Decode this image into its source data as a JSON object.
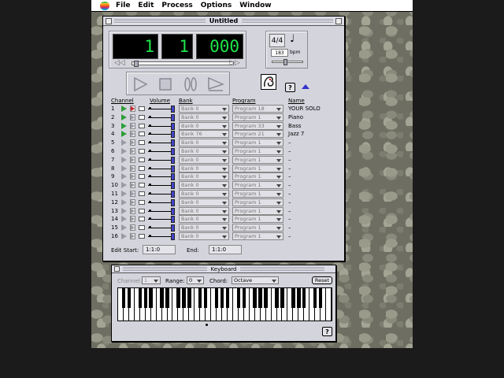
{
  "menubar": {
    "items": [
      "File",
      "Edit",
      "Process",
      "Options",
      "Window"
    ]
  },
  "main_window": {
    "title": "Untitled",
    "counter": {
      "measure": "1",
      "beat": "1",
      "tick": "000"
    },
    "tempo": {
      "time_signature": "4/4",
      "bpm": "183",
      "bpm_label": "bpm"
    },
    "help_label": "?",
    "headers": {
      "channel": "Channel",
      "volume": "Volume",
      "bank": "Bank",
      "program": "Program",
      "name": "Name"
    },
    "channels": [
      {
        "num": "1",
        "bank": "Bank 0",
        "program": "Program 18",
        "name": "YOUR SOLO",
        "playing": true,
        "record": true
      },
      {
        "num": "2",
        "bank": "Bank 0",
        "program": "Program 1",
        "name": "Piano",
        "playing": true,
        "record": false
      },
      {
        "num": "3",
        "bank": "Bank 0",
        "program": "Program 33",
        "name": "Bass",
        "playing": true,
        "record": false
      },
      {
        "num": "4",
        "bank": "Bank 76",
        "program": "Program 21",
        "name": "Jazz 7",
        "playing": true,
        "record": false
      },
      {
        "num": "5",
        "bank": "Bank 0",
        "program": "Program 1",
        "name": "–",
        "playing": false,
        "record": false
      },
      {
        "num": "6",
        "bank": "Bank 0",
        "program": "Program 1",
        "name": "–",
        "playing": false,
        "record": false
      },
      {
        "num": "7",
        "bank": "Bank 0",
        "program": "Program 1",
        "name": "–",
        "playing": false,
        "record": false
      },
      {
        "num": "8",
        "bank": "Bank 0",
        "program": "Program 1",
        "name": "–",
        "playing": false,
        "record": false
      },
      {
        "num": "9",
        "bank": "Bank 0",
        "program": "Program 1",
        "name": "–",
        "playing": false,
        "record": false
      },
      {
        "num": "10",
        "bank": "Bank 0",
        "program": "Program 1",
        "name": "–",
        "playing": false,
        "record": false
      },
      {
        "num": "11",
        "bank": "Bank 0",
        "program": "Program 1",
        "name": "–",
        "playing": false,
        "record": false
      },
      {
        "num": "12",
        "bank": "Bank 0",
        "program": "Program 1",
        "name": "–",
        "playing": false,
        "record": false
      },
      {
        "num": "13",
        "bank": "Bank 0",
        "program": "Program 1",
        "name": "–",
        "playing": false,
        "record": false
      },
      {
        "num": "14",
        "bank": "Bank 0",
        "program": "Program 1",
        "name": "–",
        "playing": false,
        "record": false
      },
      {
        "num": "15",
        "bank": "Bank 0",
        "program": "Program 1",
        "name": "–",
        "playing": false,
        "record": false
      },
      {
        "num": "16",
        "bank": "Bank 0",
        "program": "Program 1",
        "name": "–",
        "playing": false,
        "record": false
      }
    ],
    "edit_start_label": "Edit Start:",
    "edit_start_value": "1:1:0",
    "end_label": "End:",
    "end_value": "1:1:0"
  },
  "keyboard_window": {
    "title": "Keyboard",
    "channel_label": "Channel:",
    "channel_value": "1",
    "range_label": "Range:",
    "range_value": "0",
    "chord_label": "Chord:",
    "chord_value": "Octave",
    "reset_label": "Reset",
    "help_label": "?"
  },
  "colors": {
    "led_green": "#1ee64a",
    "play_on": "#2e9e38",
    "record_on": "#cc2222",
    "accent_blue": "#4444cc"
  }
}
